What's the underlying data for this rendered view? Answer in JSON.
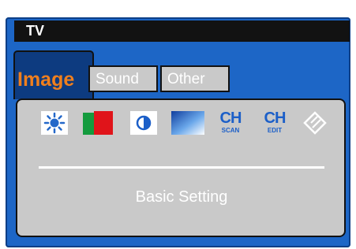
{
  "window": {
    "title": "TV"
  },
  "tabs": [
    {
      "label": "Image",
      "active": true
    },
    {
      "label": "Sound",
      "active": false
    },
    {
      "label": "Other",
      "active": false
    }
  ],
  "icons": [
    {
      "name": "brightness-icon"
    },
    {
      "name": "color-icon"
    },
    {
      "name": "contrast-icon"
    },
    {
      "name": "tint-icon"
    },
    {
      "name": "channel-scan-icon",
      "big": "CH",
      "small": "SCAN"
    },
    {
      "name": "channel-edit-icon",
      "big": "CH",
      "small": "EDIT"
    },
    {
      "name": "diamond-icon"
    }
  ],
  "section": {
    "label": "Basic Setting"
  },
  "colors": {
    "frame": "#1d66c6",
    "panel": "#c9c9c9",
    "active_tab_text": "#f07f1d",
    "icon_blue": "#1c5fc8",
    "title_bar": "#121212"
  }
}
